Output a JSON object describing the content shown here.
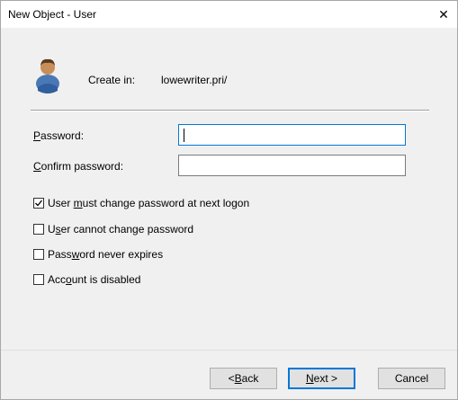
{
  "window": {
    "title": "New Object - User",
    "close_glyph": "✕"
  },
  "header": {
    "icon": "user-icon",
    "create_in_label": "Create in:",
    "create_in_value": "lowewriter.pri/"
  },
  "fields": {
    "password": {
      "label_pre": "",
      "label_ul": "P",
      "label_post": "assword:",
      "value": ""
    },
    "confirm": {
      "label_pre": "",
      "label_ul": "C",
      "label_post": "onfirm password:",
      "value": ""
    }
  },
  "options": [
    {
      "pre": "User ",
      "ul": "m",
      "post": "ust change password at next logon",
      "checked": true
    },
    {
      "pre": "U",
      "ul": "s",
      "post": "er cannot change password",
      "checked": false
    },
    {
      "pre": "Pass",
      "ul": "w",
      "post": "ord never expires",
      "checked": false
    },
    {
      "pre": "Acc",
      "ul": "o",
      "post": "unt is disabled",
      "checked": false
    }
  ],
  "buttons": {
    "back": {
      "pre": "< ",
      "ul": "B",
      "post": "ack"
    },
    "next": {
      "pre": "",
      "ul": "N",
      "post": "ext >"
    },
    "cancel": {
      "label": "Cancel"
    }
  },
  "colors": {
    "accent": "#0078d7",
    "dialog_bg": "#f0f0f0"
  }
}
